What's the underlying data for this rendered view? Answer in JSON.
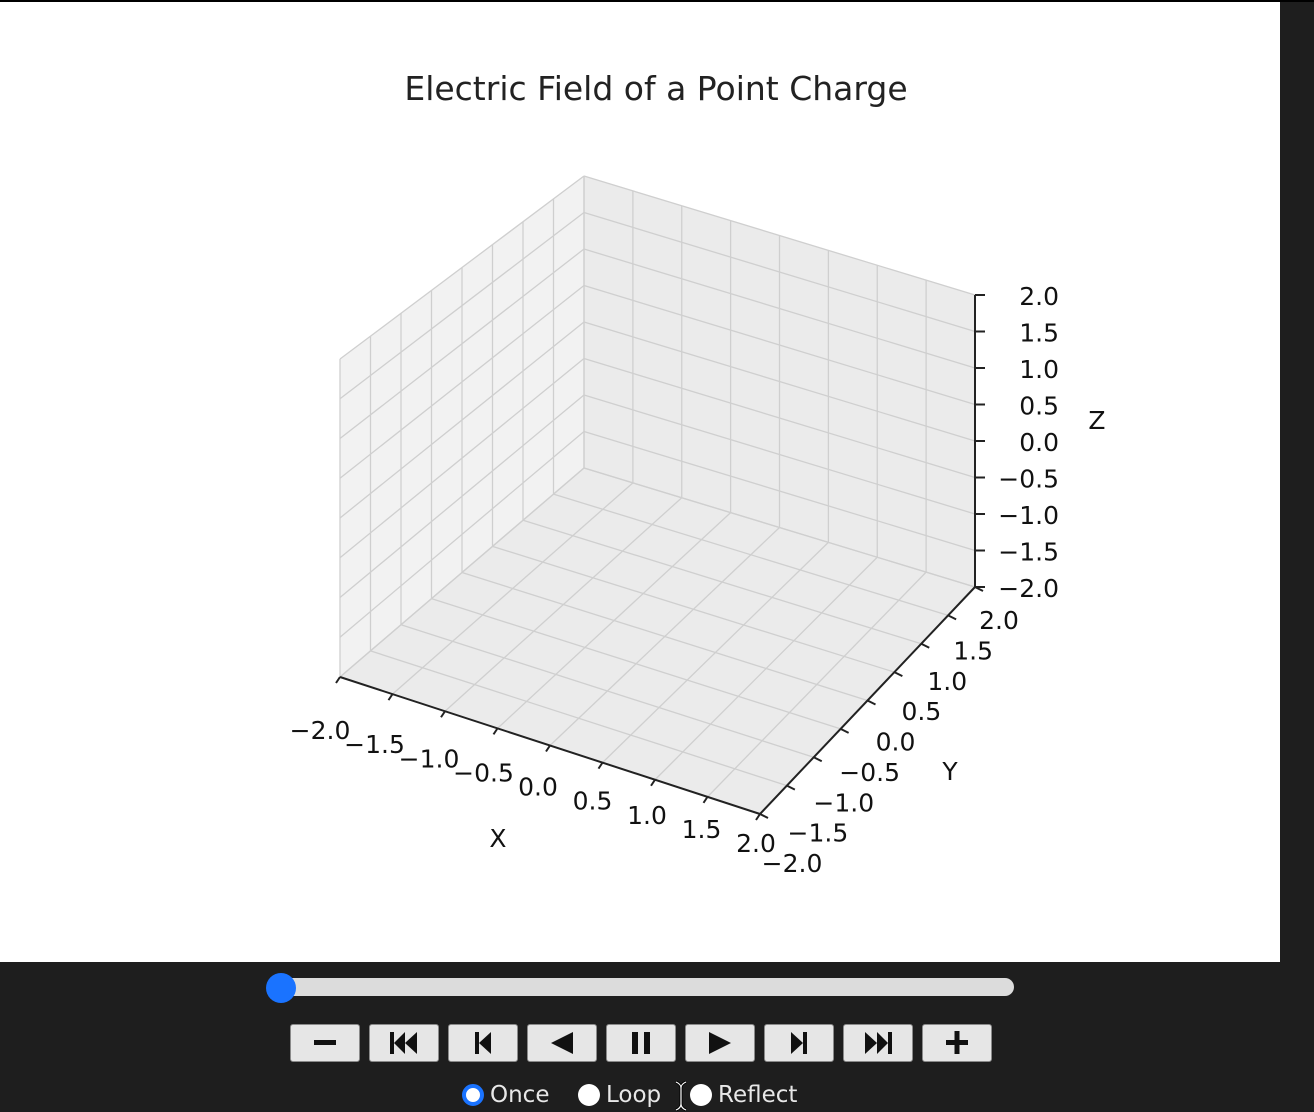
{
  "figure": {
    "title": "Electric Field of a Point Charge"
  },
  "chart_data": {
    "type": "3d-axes",
    "title": "Electric Field of a Point Charge",
    "xlabel": "X",
    "ylabel": "Y",
    "zlabel": "Z",
    "xlim": [
      -2.0,
      2.0
    ],
    "ylim": [
      -2.0,
      2.0
    ],
    "zlim": [
      -2.0,
      2.0
    ],
    "xticks": [
      "−2.0",
      "−1.5",
      "−1.0",
      "−0.5",
      "0.0",
      "0.5",
      "1.0",
      "1.5",
      "2.0"
    ],
    "yticks": [
      "−2.0",
      "−1.5",
      "−1.0",
      "−0.5",
      "0.0",
      "0.5",
      "1.0",
      "1.5",
      "2.0"
    ],
    "zticks": [
      "−2.0",
      "−1.5",
      "−1.0",
      "−0.5",
      "0.0",
      "0.5",
      "1.0",
      "1.5",
      "2.0"
    ],
    "grid": true,
    "series": []
  },
  "player": {
    "slider_value": 0,
    "buttons": [
      {
        "name": "decrease-speed-button",
        "icon": "minus-icon"
      },
      {
        "name": "first-frame-button",
        "icon": "skip-to-start-icon"
      },
      {
        "name": "previous-frame-button",
        "icon": "step-back-icon"
      },
      {
        "name": "play-reverse-button",
        "icon": "play-reverse-icon"
      },
      {
        "name": "pause-button",
        "icon": "pause-icon"
      },
      {
        "name": "play-button",
        "icon": "play-icon"
      },
      {
        "name": "next-frame-button",
        "icon": "step-forward-icon"
      },
      {
        "name": "last-frame-button",
        "icon": "skip-to-end-icon"
      },
      {
        "name": "increase-speed-button",
        "icon": "plus-icon"
      }
    ],
    "modes": [
      {
        "label": "Once",
        "checked": true
      },
      {
        "label": "Loop",
        "checked": false
      },
      {
        "label": "Reflect",
        "checked": false
      }
    ]
  },
  "colors": {
    "accent": "#1a73ff",
    "background": "#1e1e1e"
  }
}
